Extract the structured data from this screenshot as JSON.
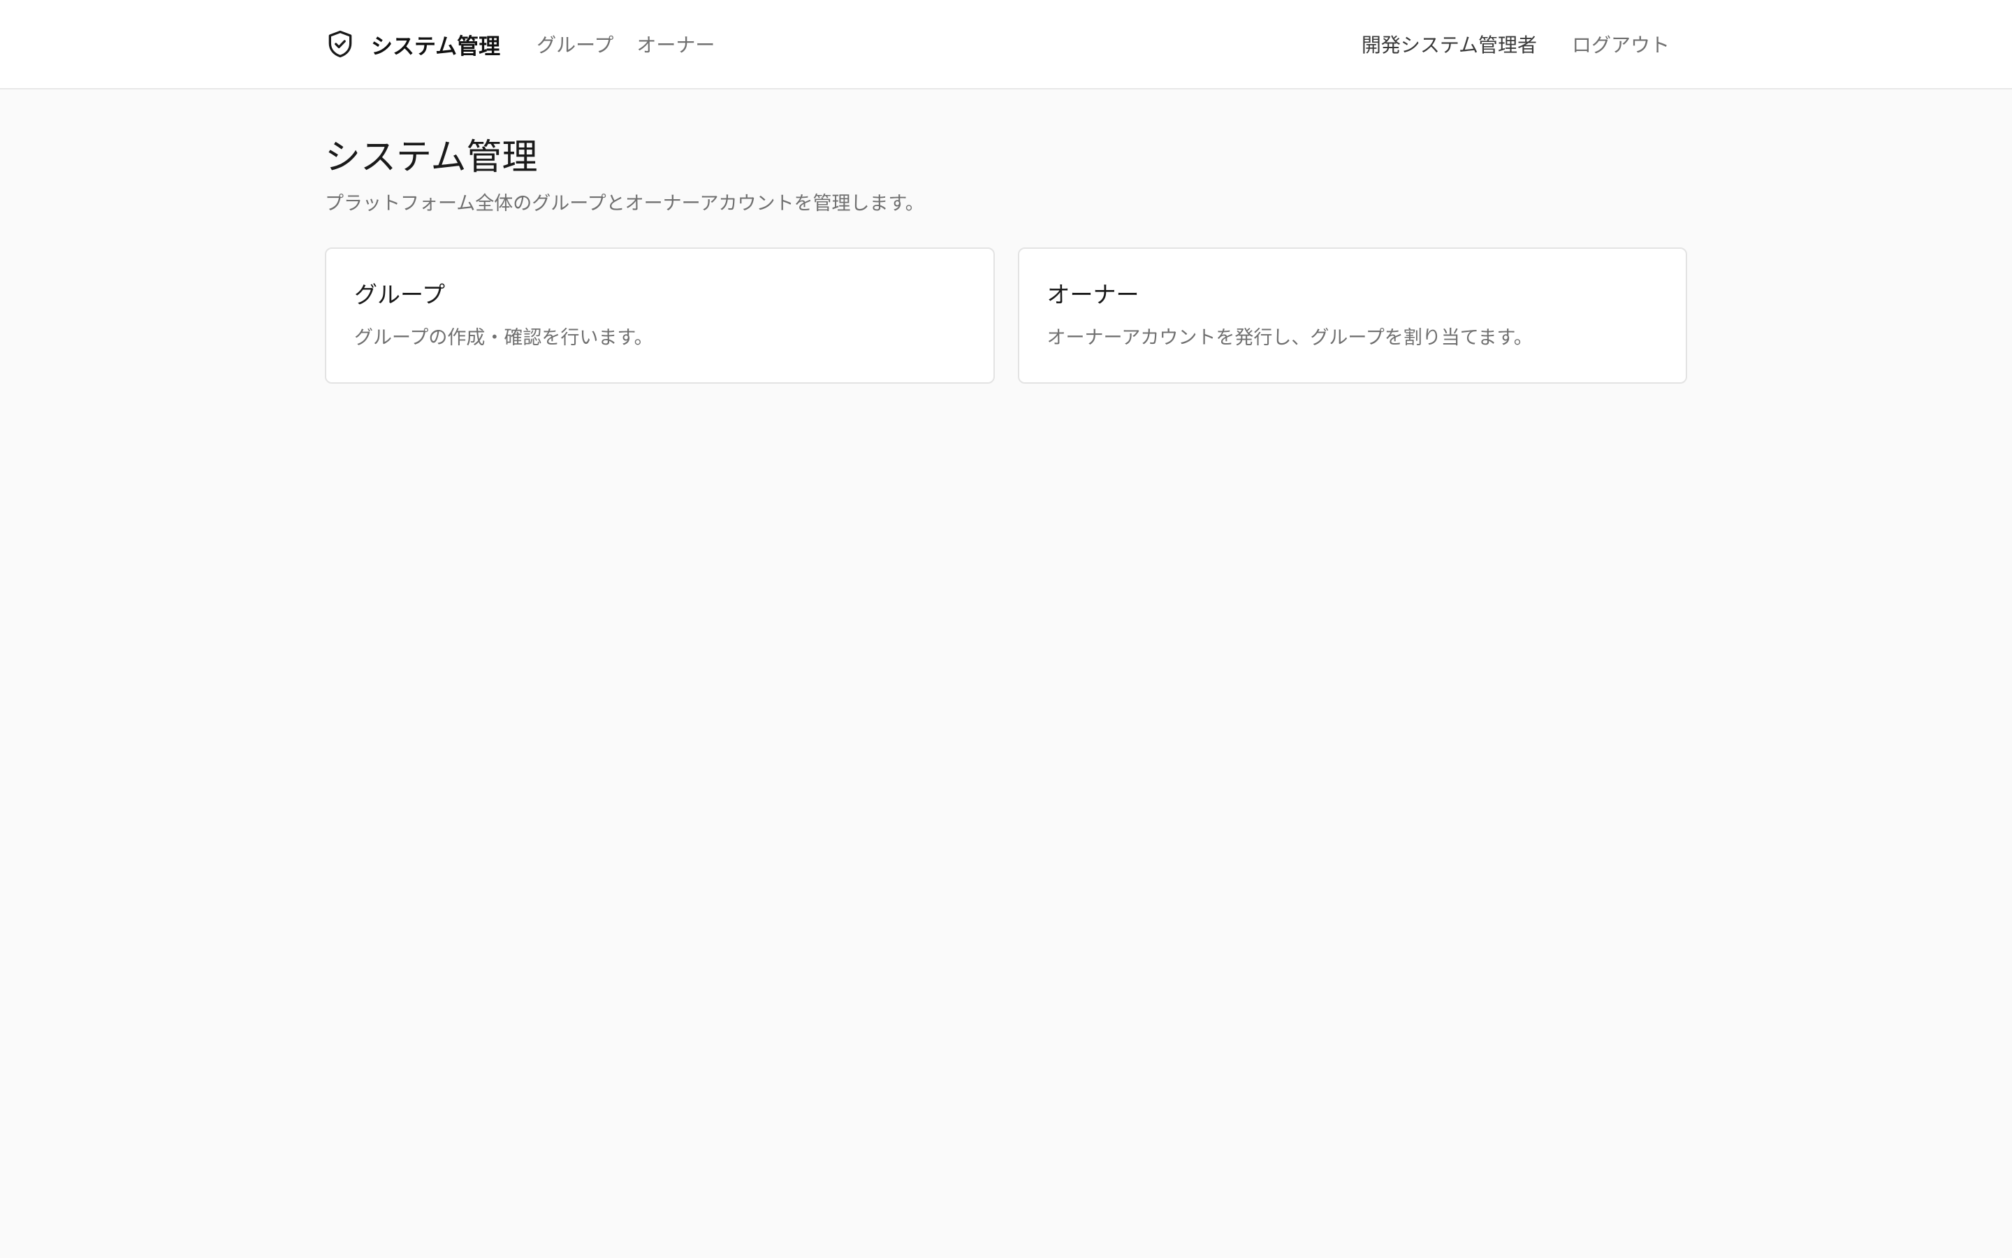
{
  "header": {
    "brand_title": "システム管理",
    "brand_icon": "shield-check-icon",
    "nav": [
      {
        "label": "グループ"
      },
      {
        "label": "オーナー"
      }
    ],
    "user_name": "開発システム管理者",
    "logout_label": "ログアウト"
  },
  "main": {
    "title": "システム管理",
    "subtitle": "プラットフォーム全体のグループとオーナーアカウントを管理します。",
    "cards": [
      {
        "title": "グループ",
        "description": "グループの作成・確認を行います。"
      },
      {
        "title": "オーナー",
        "description": "オーナーアカウントを発行し、グループを割り当てます。"
      }
    ]
  },
  "colors": {
    "page_background": "#fafafa",
    "header_background": "#ffffff",
    "text_primary": "#1a1a1a",
    "text_secondary": "#707070",
    "border": "#e3e3e3"
  }
}
